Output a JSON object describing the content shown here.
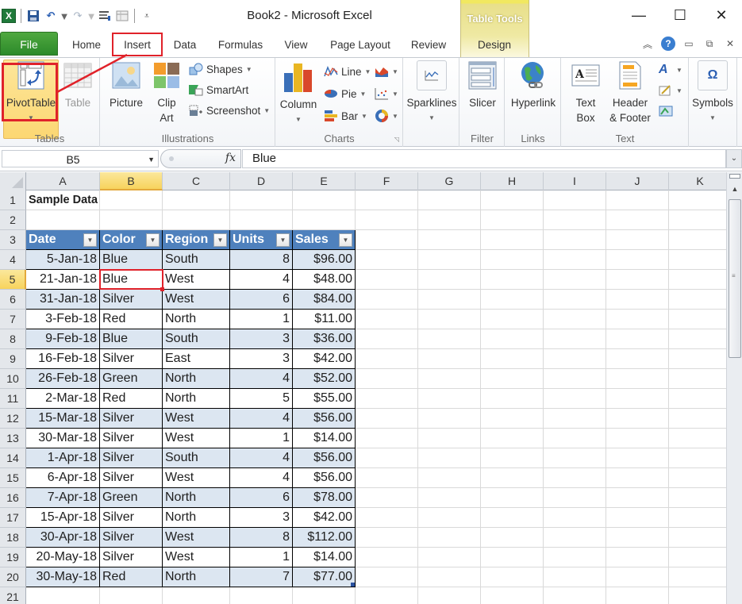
{
  "window": {
    "title": "Book2  -  Microsoft Excel",
    "contextual_tab_group": "Table Tools",
    "controls": {
      "minimize": "—",
      "maximize": "☐",
      "close": "✕"
    }
  },
  "quick_access": {
    "icons": [
      "excel-logo",
      "save-icon",
      "undo-icon",
      "redo-icon",
      "form-icon",
      "table-icon",
      "customize-icon"
    ]
  },
  "tabs": [
    {
      "label": "File"
    },
    {
      "label": "Home"
    },
    {
      "label": "Insert",
      "active": true
    },
    {
      "label": "Data"
    },
    {
      "label": "Formulas"
    },
    {
      "label": "View"
    },
    {
      "label": "Page Layout"
    },
    {
      "label": "Review"
    },
    {
      "label": "Design"
    }
  ],
  "ribbon_right_icons": {
    "collapse": "︽",
    "help": "?",
    "minimize": "▭",
    "restore": "⧉",
    "close": "✕"
  },
  "ribbon": {
    "groups": {
      "tables": {
        "label": "Tables",
        "pivot_table": "PivotTable",
        "table": "Table"
      },
      "illustrations": {
        "label": "Illustrations",
        "picture": "Picture",
        "clip_art_1": "Clip",
        "clip_art_2": "Art",
        "shapes": "Shapes",
        "smartart": "SmartArt",
        "screenshot": "Screenshot"
      },
      "charts": {
        "label": "Charts",
        "column": "Column",
        "line": "Line",
        "pie": "Pie",
        "bar": "Bar"
      },
      "sparklines": {
        "label": "",
        "button": "Sparklines"
      },
      "filter": {
        "label": "Filter",
        "slicer": "Slicer"
      },
      "links": {
        "label": "Links",
        "hyperlink": "Hyperlink"
      },
      "text": {
        "label": "Text",
        "text_box_1": "Text",
        "text_box_2": "Box",
        "header_footer_1": "Header",
        "header_footer_2": "& Footer"
      },
      "symbols": {
        "label": "",
        "button": "Symbols"
      }
    }
  },
  "formula_bar": {
    "name_box": "B5",
    "fx": "fx",
    "value": "Blue"
  },
  "sheet": {
    "columns": [
      "A",
      "B",
      "C",
      "D",
      "E",
      "F",
      "G",
      "H",
      "I",
      "J",
      "K"
    ],
    "active_column": "B",
    "active_row": 5,
    "row_numbers": [
      "1",
      "2",
      "3",
      "4",
      "5",
      "6",
      "7",
      "8",
      "9",
      "10",
      "11",
      "12",
      "13",
      "14",
      "15",
      "16",
      "17",
      "18",
      "19",
      "20",
      "21"
    ],
    "title_cell": "Sample Data",
    "table_headers": [
      "Date",
      "Color",
      "Region",
      "Units",
      "Sales"
    ],
    "table_rows": [
      [
        "5-Jan-18",
        "Blue",
        "South",
        "8",
        "$96.00"
      ],
      [
        "21-Jan-18",
        "Blue",
        "West",
        "4",
        "$48.00"
      ],
      [
        "31-Jan-18",
        "Silver",
        "West",
        "6",
        "$84.00"
      ],
      [
        "3-Feb-18",
        "Red",
        "North",
        "1",
        "$11.00"
      ],
      [
        "9-Feb-18",
        "Blue",
        "South",
        "3",
        "$36.00"
      ],
      [
        "16-Feb-18",
        "Silver",
        "East",
        "3",
        "$42.00"
      ],
      [
        "26-Feb-18",
        "Green",
        "North",
        "4",
        "$52.00"
      ],
      [
        "2-Mar-18",
        "Red",
        "North",
        "5",
        "$55.00"
      ],
      [
        "15-Mar-18",
        "Silver",
        "West",
        "4",
        "$56.00"
      ],
      [
        "30-Mar-18",
        "Silver",
        "West",
        "1",
        "$14.00"
      ],
      [
        "1-Apr-18",
        "Silver",
        "South",
        "4",
        "$56.00"
      ],
      [
        "6-Apr-18",
        "Silver",
        "West",
        "4",
        "$56.00"
      ],
      [
        "7-Apr-18",
        "Green",
        "North",
        "6",
        "$78.00"
      ],
      [
        "15-Apr-18",
        "Silver",
        "North",
        "3",
        "$42.00"
      ],
      [
        "30-Apr-18",
        "Silver",
        "West",
        "8",
        "$112.00"
      ],
      [
        "20-May-18",
        "Silver",
        "West",
        "1",
        "$14.00"
      ],
      [
        "30-May-18",
        "Red",
        "North",
        "7",
        "$77.00"
      ]
    ]
  },
  "colors": {
    "table_header": "#4f81bd",
    "table_band": "#dce6f1",
    "annotation_red": "#e0222a",
    "file_tab": "#2c8a2a",
    "active_header": "#f7d35c"
  }
}
